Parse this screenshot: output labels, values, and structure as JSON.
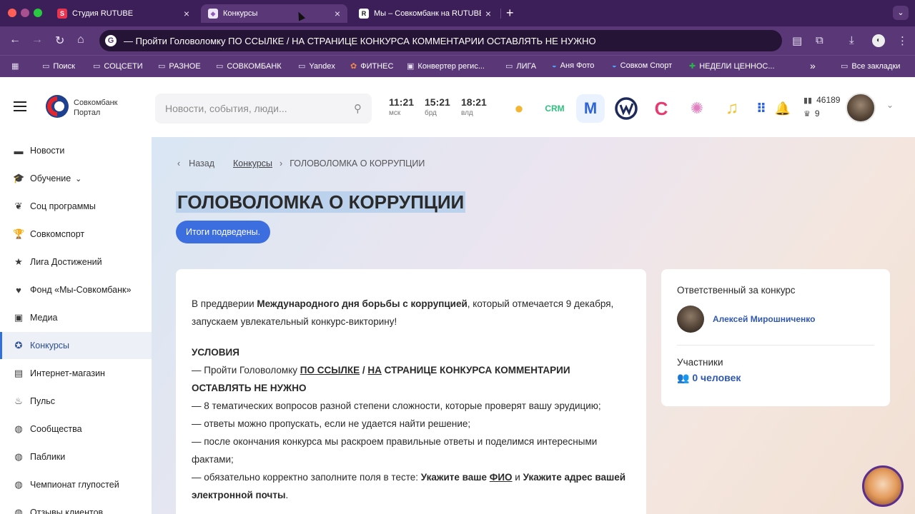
{
  "browser": {
    "tabs": [
      {
        "favicon": "S",
        "title": "Студия RUTUBE",
        "favicon_color": "#e8344e"
      },
      {
        "favicon": "◆",
        "title": "Конкурсы",
        "favicon_color": "#8e5bb8"
      },
      {
        "favicon": "R",
        "title": "Мы – Совкомбанк на RUTUBE",
        "favicon_color": "#1a1a1a"
      }
    ],
    "address": "— Пройти Головоломку ПО ССЫЛКЕ / НА СТРАНИЦЕ КОНКУРСА КОММЕНТАРИИ ОСТАВЛЯТЬ НЕ НУЖНО",
    "bookmarks": [
      "Поиск",
      "СОЦСЕТИ",
      "РАЗНОЕ",
      "СОВКОМБАНК",
      "Yandex",
      "ФИТНЕС",
      "Конвертер регис...",
      "ЛИГА",
      "Аня Фото",
      "Совком Спорт",
      "НЕДЕЛИ ЦЕННОС..."
    ],
    "all_bookmarks": "Все закладки",
    "chevrons": "»"
  },
  "header": {
    "logo_line1": "Совкомбанк",
    "logo_line2": "Портал",
    "search_placeholder": "Новости, события, люди...",
    "clocks": [
      {
        "time": "11:21",
        "city": "мск"
      },
      {
        "time": "15:21",
        "city": "брд"
      },
      {
        "time": "18:21",
        "city": "влд"
      }
    ],
    "apps": {
      "crm": "CRM",
      "m": "M",
      "c": "C"
    },
    "stats": {
      "rating": "46189",
      "medals": "9"
    }
  },
  "sidebar": {
    "items": [
      {
        "label": "Новости",
        "icon": "newspaper-icon"
      },
      {
        "label": "Обучение",
        "icon": "graduation-cap-icon"
      },
      {
        "label": "Соц программы",
        "icon": "leaf-icon"
      },
      {
        "label": "Совкомспорт",
        "icon": "trophy-icon"
      },
      {
        "label": "Лига Достижений",
        "icon": "star-icon"
      },
      {
        "label": "Фонд «Мы-Совкомбанк»",
        "icon": "heart-icon"
      },
      {
        "label": "Медиа",
        "icon": "book-icon"
      },
      {
        "label": "Конкурсы",
        "icon": "medal-icon"
      },
      {
        "label": "Интернет-магазин",
        "icon": "cart-icon"
      },
      {
        "label": "Пульс",
        "icon": "flame-icon"
      },
      {
        "label": "Сообщества",
        "icon": "chat-icon"
      },
      {
        "label": "Паблики",
        "icon": "chat-icon"
      },
      {
        "label": "Чемпионат глупостей",
        "icon": "chat-icon"
      },
      {
        "label": "Отзывы клиентов",
        "icon": "chat-icon"
      }
    ],
    "expand_mark": "⌄"
  },
  "breadcrumbs": {
    "back": "Назад",
    "parent": "Конкурсы",
    "current": "ГОЛОВОЛОМКА О КОРРУПЦИИ"
  },
  "contest": {
    "title": "ГОЛОВОЛОМКА О КОРРУПЦИИ",
    "status": "Итоги подведены.",
    "intro_1": "В преддверии ",
    "intro_bold": "Международного дня борьбы с коррупцией",
    "intro_2": ", который отмечается 9 декабря, запускаем увлекательный конкурс-викторину!",
    "conditions_title": "УСЛОВИЯ",
    "c1_prefix": "— Пройти Головоломку ",
    "c1_link1": "ПО ССЫЛКЕ",
    "c1_sep": " / ",
    "c1_link2": "НА",
    "c1_rest": " СТРАНИЦЕ КОНКУРСА КОММЕНТАРИИ ОСТАВЛЯТЬ НЕ НУЖНО",
    "c2": "— 8 тематических вопросов разной степени сложности, которые проверят вашу эрудицию;",
    "c3": "— ответы можно пропускать, если не удается найти решение;",
    "c4": "— после окончания конкурса мы раскроем правильные ответы и поделимся интересными фактами;",
    "c5_prefix": "— обязательно корректно заполните поля в тесте: ",
    "c5_b1": "Укажите ваше ",
    "c5_u": "ФИО",
    "c5_and": " и ",
    "c5_b2": "Укажите адрес вашей электронной почты",
    "c5_end": "."
  },
  "sidepanel": {
    "responsible_title": "Ответственный за конкурс",
    "responsible_name": "Алексей Мирошниченко",
    "participants_title": "Участники",
    "participants_count": "0 человек"
  },
  "colors": {
    "accent": "#3c6ee0",
    "link": "#3058b0",
    "chrome": "#5a3878"
  }
}
